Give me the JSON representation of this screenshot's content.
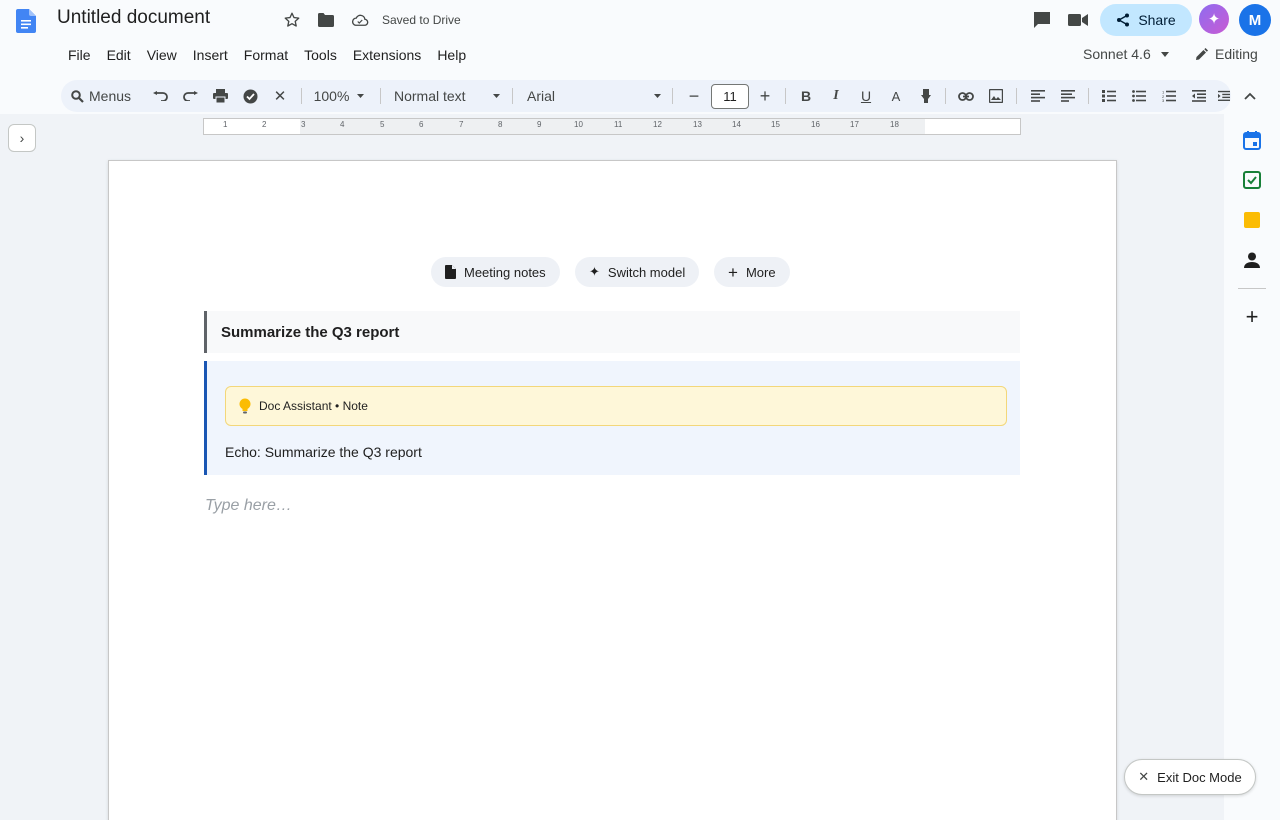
{
  "header": {
    "doc_title": "Untitled document",
    "saved_status": "Saved to Drive",
    "share_label": "Share",
    "avatar_initial": "M"
  },
  "menu": {
    "items": [
      "File",
      "Edit",
      "View",
      "Insert",
      "Format",
      "Tools",
      "Extensions",
      "Help"
    ],
    "model": "Sonnet 4.6",
    "mode": "Editing"
  },
  "toolbar": {
    "search_label": "Menus",
    "zoom": "100%",
    "style": "Normal text",
    "font": "Arial",
    "font_size": "11"
  },
  "ruler": {
    "numbers": [
      "1",
      "2",
      "3",
      "4",
      "5",
      "6",
      "7",
      "8",
      "9",
      "10",
      "11",
      "12",
      "13",
      "14",
      "15",
      "16",
      "17",
      "18"
    ]
  },
  "chips": {
    "meeting_notes": "Meeting notes",
    "switch_model": "Switch model",
    "more": "More"
  },
  "document": {
    "prompt": "Summarize the Q3 report",
    "note_label": "Doc Assistant • Note",
    "reply": "Echo: Summarize the Q3 report",
    "placeholder": "Type here…"
  },
  "exit_label": "Exit Doc Mode",
  "colors": {
    "accent": "#1a73e8",
    "share_bg": "#c2e7ff",
    "note_bg": "#fef7d9",
    "reply_border": "#1a56b3"
  }
}
